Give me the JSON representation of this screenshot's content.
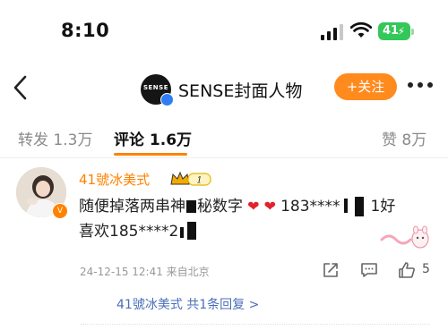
{
  "status_bar": {
    "time": "8:10",
    "battery_level": "41"
  },
  "header": {
    "account_name": "SENSE封面人物",
    "logo_text": "SENSE",
    "follow_label": "+关注"
  },
  "tabs": [
    {
      "label": "转发 1.3万",
      "active": false
    },
    {
      "label": "评论 1.6万",
      "active": true
    },
    {
      "label": "赞 8万",
      "active": false
    }
  ],
  "comment": {
    "user_name": "41號冰美式",
    "rank_level": "1",
    "line1_a": "随便掉落两串神",
    "line1_b": "秘数字",
    "line1_c": "183****",
    "line1_d": "1好",
    "line2_a": "喜欢185****2",
    "meta": "24-12-15 12:41 来自北京",
    "like_count": "5",
    "reply_summary": "41號冰美式  共1条回复 >"
  },
  "colors": {
    "accent": "#ff8200",
    "link": "#4a6fb8",
    "verify": "#2f7df6",
    "battery": "#34c759"
  },
  "icons": [
    "back-chevron-icon",
    "signal-icon",
    "wifi-icon",
    "battery-icon",
    "verified-icon",
    "more-icon",
    "share-icon",
    "comment-icon",
    "like-icon",
    "heart-emoji-icon"
  ]
}
